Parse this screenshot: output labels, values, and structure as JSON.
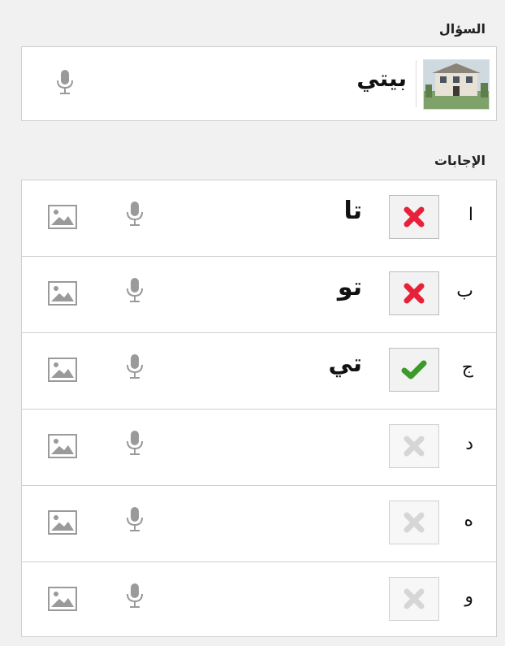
{
  "question": {
    "section_title": "السؤال",
    "text": "بيتي"
  },
  "answers": {
    "section_title": "الإجابات",
    "rows": [
      {
        "letter": "ا",
        "text": "تا",
        "status": "wrong"
      },
      {
        "letter": "ب",
        "text": "تو",
        "status": "wrong"
      },
      {
        "letter": "ج",
        "text": "تي",
        "status": "correct"
      },
      {
        "letter": "د",
        "text": "",
        "status": "empty"
      },
      {
        "letter": "ه",
        "text": "",
        "status": "empty"
      },
      {
        "letter": "و",
        "text": "",
        "status": "empty"
      }
    ]
  },
  "colors": {
    "wrong": "#e8213a",
    "correct": "#3c9a2a",
    "empty": "#d6d6d6",
    "icon_gray": "#9a9a9a"
  },
  "icons": {
    "mic": "microphone-icon",
    "image": "image-icon",
    "wrong": "x-mark-icon",
    "correct": "check-mark-icon"
  }
}
